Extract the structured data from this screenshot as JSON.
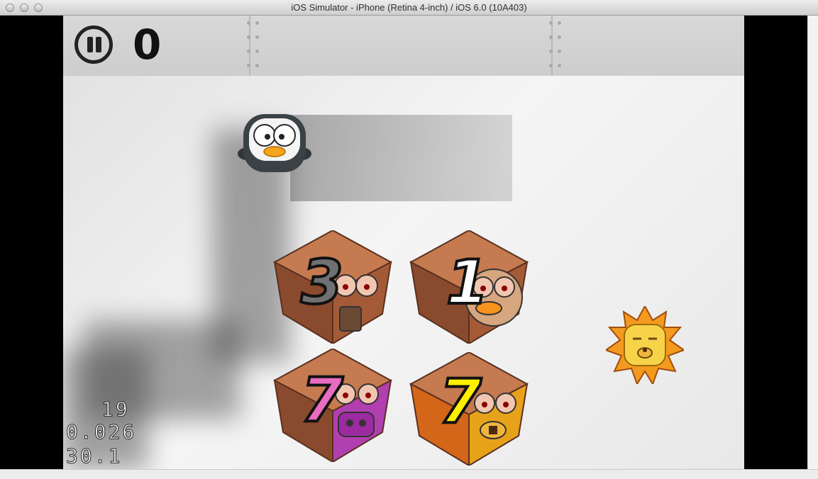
{
  "window": {
    "title": "iOS Simulator - iPhone (Retina 4-inch) / iOS 6.0 (10A403)"
  },
  "hud": {
    "score": "0",
    "pause_icon": "pause-icon"
  },
  "crates": [
    {
      "number": "3",
      "animal": "owl",
      "number_color": "#6f7071"
    },
    {
      "number": "1",
      "animal": "monkey",
      "number_color": "#ffffff"
    },
    {
      "number": "7",
      "animal": "pig",
      "number_color": "#e86cc0"
    },
    {
      "number": "7",
      "animal": "lion",
      "number_color": "#fff000"
    }
  ],
  "characters": {
    "player": "penguin",
    "enemy": "lion"
  },
  "debug": {
    "line1": "19",
    "line2": "0.026",
    "line3": "30.1"
  }
}
